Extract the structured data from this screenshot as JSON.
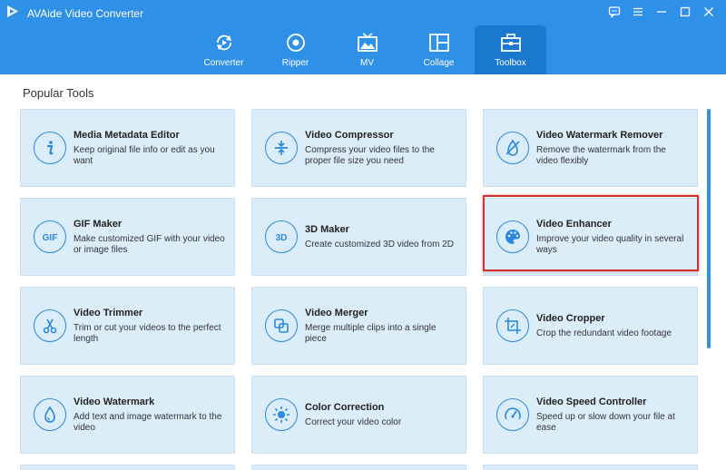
{
  "app": {
    "title": "AVAide Video Converter"
  },
  "colors": {
    "header": "#2f90e8",
    "accent": "#2a89dd",
    "card_bg": "#dcedfa",
    "highlight": "#d62f2f"
  },
  "window_controls": [
    {
      "icon": "feedback-icon"
    },
    {
      "icon": "menu-icon"
    },
    {
      "icon": "minimize-icon"
    },
    {
      "icon": "maximize-icon"
    },
    {
      "icon": "close-icon"
    }
  ],
  "nav": [
    {
      "label": "Converter",
      "icon": "converter-icon"
    },
    {
      "label": "Ripper",
      "icon": "ripper-icon"
    },
    {
      "label": "MV",
      "icon": "mv-icon"
    },
    {
      "label": "Collage",
      "icon": "collage-icon"
    },
    {
      "label": "Toolbox",
      "icon": "toolbox-icon",
      "active": true
    }
  ],
  "section_title": "Popular Tools",
  "tools": [
    {
      "title": "Media Metadata Editor",
      "desc": "Keep original file info or edit as you want",
      "icon": "info-icon"
    },
    {
      "title": "Video Compressor",
      "desc": "Compress your video files to the proper file size you need",
      "icon": "compress-icon"
    },
    {
      "title": "Video Watermark Remover",
      "desc": "Remove the watermark from the video flexibly",
      "icon": "watermark-remove-icon"
    },
    {
      "title": "GIF Maker",
      "desc": "Make customized GIF with your video or image files",
      "icon": "gif-icon"
    },
    {
      "title": "3D Maker",
      "desc": "Create customized 3D video from 2D",
      "icon": "3d-icon"
    },
    {
      "title": "Video Enhancer",
      "desc": "Improve your video quality in several ways",
      "icon": "palette-icon",
      "highlighted": true
    },
    {
      "title": "Video Trimmer",
      "desc": "Trim or cut your videos to the perfect length",
      "icon": "scissors-icon"
    },
    {
      "title": "Video Merger",
      "desc": "Merge multiple clips into a single piece",
      "icon": "merge-icon"
    },
    {
      "title": "Video Cropper",
      "desc": "Crop the redundant video footage",
      "icon": "crop-icon"
    },
    {
      "title": "Video Watermark",
      "desc": "Add text and image watermark to the video",
      "icon": "drop-icon"
    },
    {
      "title": "Color Correction",
      "desc": "Correct your video color",
      "icon": "sun-icon"
    },
    {
      "title": "Video Speed Controller",
      "desc": "Speed up or slow down your file at ease",
      "icon": "speed-icon"
    }
  ]
}
